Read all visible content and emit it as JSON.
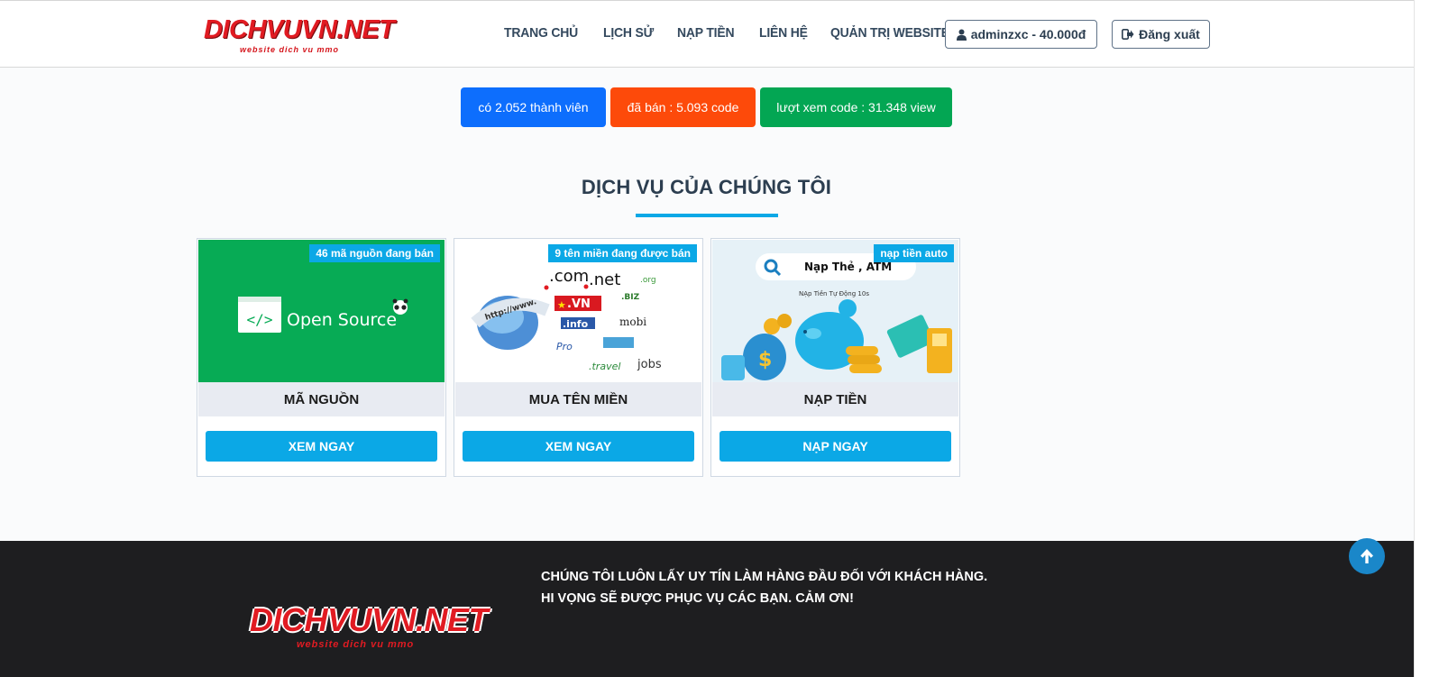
{
  "header": {
    "logo_text": "DICHVUVN.NET",
    "logo_tagline": "website dich vu mmo",
    "nav": [
      {
        "label": "TRANG CHỦ"
      },
      {
        "label": "LỊCH SỬ"
      },
      {
        "label": "NẠP TIỀN"
      },
      {
        "label": "LIÊN HỆ"
      },
      {
        "label": "QUẢN TRỊ WEBSITE"
      }
    ],
    "user_button": "adminzxc - 40.000đ",
    "logout_button": "Đăng xuất"
  },
  "stats": {
    "members": "có 2.052 thành viên",
    "sold": "đã bán : 5.093 code",
    "views": "lượt xem code : 31.348 view"
  },
  "section": {
    "title": "DỊCH VỤ CỦA CHÚNG TÔI"
  },
  "cards": [
    {
      "badge": "46 mã nguồn đang bán",
      "image_text": "Open Source",
      "label": "MÃ NGUỒN",
      "cta": "XEM NGAY"
    },
    {
      "badge": "9 tên miền đang được bán",
      "image_domains": [
        ".com",
        ".net",
        ".org",
        ".VN",
        ".BIZ",
        ".info",
        "mobi",
        "Pro",
        ".travel",
        "jobs",
        "http://www."
      ],
      "label": "MUA TÊN MIỀN",
      "cta": "XEM NGAY"
    },
    {
      "badge": "nạp tiền auto",
      "image_search": "Nạp Thẻ , ATM",
      "image_sub": "NẠp Tiền Tự Động 10s",
      "label": "NẠP TIỀN",
      "cta": "NẠP NGAY"
    }
  ],
  "footer": {
    "logo_text": "DICHVUVN.NET",
    "logo_tagline": "website dich vu mmo",
    "message_line1": "CHÚNG TÔI LUÔN LẤY UY TÍN LÀM HÀNG ĐẦU ĐỐI VỚI KHÁCH HÀNG.",
    "message_line2": "HI VỌNG SẼ ĐƯỢC PHỤC VỤ CÁC BẠN. CẢM ƠN!"
  },
  "colors": {
    "accent": "#0ba8e6",
    "stat_blue": "#0d6efd",
    "stat_orange": "#fd4a0a",
    "stat_green": "#03a653",
    "logo_red": "#e11b22",
    "footer_bg": "#1e1e20"
  }
}
